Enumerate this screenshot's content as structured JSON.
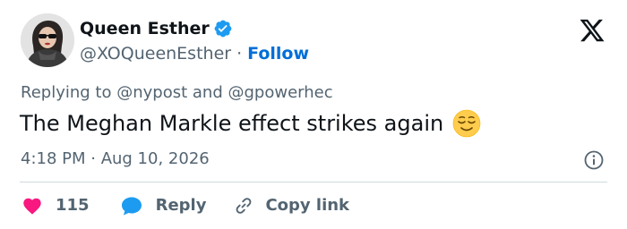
{
  "header": {
    "display_name": "Queen Esther",
    "handle": "@XOQueenEsther",
    "separator": "·",
    "follow_label": "Follow"
  },
  "tweet": {
    "reply_prefix": "Replying to",
    "reply_mention_1": "@nypost",
    "reply_and": "and",
    "reply_mention_2": "@gpowerhec",
    "text": "The Meghan Markle effect strikes again",
    "emoji": "relieved-face",
    "timestamp": "4:18 PM · Aug 10, 2026"
  },
  "actions": {
    "like_count": "115",
    "reply_label": "Reply",
    "copy_label": "Copy link"
  },
  "colors": {
    "link_blue": "#006fd6",
    "verified_blue": "#1d9bf0",
    "like_pink": "#f91880",
    "reply_blue": "#1d9bf0",
    "secondary_text": "#536471",
    "primary_text": "#0f1419"
  }
}
